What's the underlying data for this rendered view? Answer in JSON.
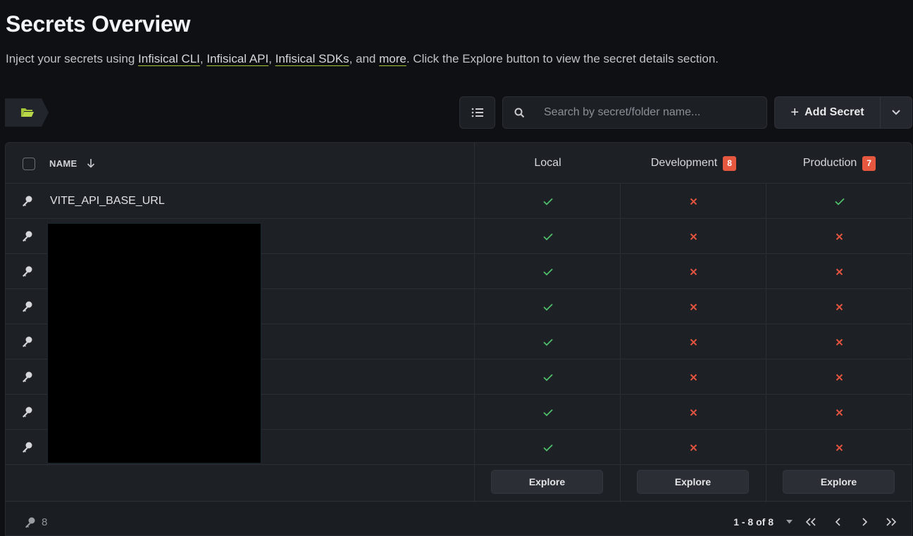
{
  "page": {
    "title": "Secrets Overview",
    "subtitle_pre": "Inject your secrets using ",
    "links": [
      "Infisical CLI",
      "Infisical API",
      "Infisical SDKs",
      "more"
    ],
    "sep1": ", ",
    "sep2": ", ",
    "sep3": ", and ",
    "subtitle_post": ". Click the Explore button to view the secret details section."
  },
  "toolbar": {
    "search_placeholder": "Search by secret/folder name...",
    "add_secret_label": "Add Secret"
  },
  "table": {
    "name_header": "NAME",
    "environments": [
      {
        "name": "Local",
        "badge": ""
      },
      {
        "name": "Development",
        "badge": "8"
      },
      {
        "name": "Production",
        "badge": "7"
      }
    ],
    "rows": [
      {
        "name": "VITE_API_BASE_URL",
        "status": [
          true,
          false,
          true
        ]
      },
      {
        "name": "",
        "status": [
          true,
          false,
          false
        ]
      },
      {
        "name": "",
        "status": [
          true,
          false,
          false
        ]
      },
      {
        "name": "",
        "status": [
          true,
          false,
          false
        ]
      },
      {
        "name": "",
        "status": [
          true,
          false,
          false
        ]
      },
      {
        "name": "",
        "status": [
          true,
          false,
          false
        ]
      },
      {
        "name": "",
        "status": [
          true,
          false,
          false
        ]
      },
      {
        "name": "",
        "status": [
          true,
          false,
          false
        ]
      }
    ],
    "explore_label": "Explore",
    "secret_count": "8"
  },
  "pagination": {
    "range": "1 - 8 of 8"
  },
  "colors": {
    "ok": "#4fbf6b",
    "missing": "#e0533e",
    "badge": "#e5573f",
    "accent_underline": "#a4c639"
  },
  "icons": {
    "breadcrumb": "folder-open-icon",
    "view": "list-icon",
    "search": "search-icon",
    "add": "plus-icon",
    "row": "key-icon"
  }
}
